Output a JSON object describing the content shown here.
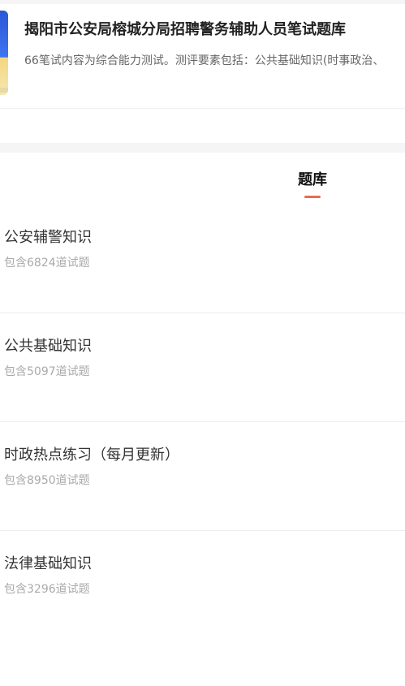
{
  "header": {
    "title": "揭阳市公安局榕城分局招聘警务辅助人员笔试题库",
    "description": "66笔试内容为综合能力测试。测评要素包括：公共基础知识(时事政治、"
  },
  "tabs": [
    {
      "label": "题库",
      "active": true
    }
  ],
  "colors": {
    "accent": "#e96a4d",
    "cover_blue": "#3f74f0",
    "cover_yellow": "#f3d77f"
  },
  "question_banks": [
    {
      "name": "公安辅警知识",
      "count_text": "包含6824道试题"
    },
    {
      "name": "公共基础知识",
      "count_text": "包含5097道试题"
    },
    {
      "name": "时政热点练习（每月更新）",
      "count_text": "包含8950道试题"
    },
    {
      "name": "法律基础知识",
      "count_text": "包含3296道试题"
    }
  ]
}
